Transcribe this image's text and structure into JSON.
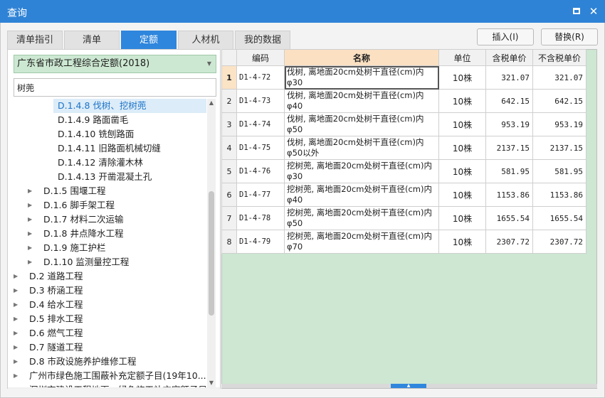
{
  "window": {
    "title": "查询"
  },
  "tabs": [
    {
      "label": "清单指引",
      "active": false
    },
    {
      "label": "清单",
      "active": false
    },
    {
      "label": "定额",
      "active": true
    },
    {
      "label": "人材机",
      "active": false
    },
    {
      "label": "我的数据",
      "active": false
    }
  ],
  "toolbar": {
    "insert_label": "插入(I)",
    "replace_label": "替换(R)"
  },
  "left": {
    "quota_library": "广东省市政工程综合定额(2018)",
    "search_value": "树蔸",
    "tree": [
      {
        "label": "D.1.4.8 伐树、挖树蔸",
        "selected": true,
        "expandable": false
      },
      {
        "label": "D.1.4.9 路面凿毛",
        "selected": false,
        "expandable": false
      },
      {
        "label": "D.1.4.10 铣刨路面",
        "selected": false,
        "expandable": false
      },
      {
        "label": "D.1.4.11 旧路面机械切缝",
        "selected": false,
        "expandable": false
      },
      {
        "label": "D.1.4.12 清除灌木林",
        "selected": false,
        "expandable": false
      },
      {
        "label": "D.1.4.13 开凿混凝土孔",
        "selected": false,
        "expandable": false
      },
      {
        "label": "D.1.5 围堰工程",
        "selected": false,
        "expandable": true
      },
      {
        "label": "D.1.6 脚手架工程",
        "selected": false,
        "expandable": true
      },
      {
        "label": "D.1.7 材料二次运输",
        "selected": false,
        "expandable": true
      },
      {
        "label": "D.1.8 井点降水工程",
        "selected": false,
        "expandable": true
      },
      {
        "label": "D.1.9 施工护栏",
        "selected": false,
        "expandable": true
      },
      {
        "label": "D.1.10 监测量控工程",
        "selected": false,
        "expandable": true
      },
      {
        "label": "D.2 道路工程",
        "selected": false,
        "expandable": true
      },
      {
        "label": "D.3 桥涵工程",
        "selected": false,
        "expandable": true
      },
      {
        "label": "D.4 给水工程",
        "selected": false,
        "expandable": true
      },
      {
        "label": "D.5 排水工程",
        "selected": false,
        "expandable": true
      },
      {
        "label": "D.6 燃气工程",
        "selected": false,
        "expandable": true
      },
      {
        "label": "D.7 隧道工程",
        "selected": false,
        "expandable": true
      },
      {
        "label": "D.8 市政设施养护维修工程",
        "selected": false,
        "expandable": true
      },
      {
        "label": "广州市绿色施工围蔽补充定额子目(19年10...",
        "selected": false,
        "expandable": true
      },
      {
        "label": "深圳市建设工程地下、绿色施工补充定额子目",
        "selected": false,
        "expandable": true
      }
    ]
  },
  "grid": {
    "columns": [
      "编码",
      "名称",
      "单位",
      "含税单价",
      "不含税单价"
    ],
    "rows": [
      {
        "n": "1",
        "code": "D1-4-72",
        "name1": "伐树, 离地面20cm处树干直径(cm)内",
        "name2": "φ30",
        "unit": "10株",
        "price_tax": "321.07",
        "price_notax": "321.07"
      },
      {
        "n": "2",
        "code": "D1-4-73",
        "name1": "伐树, 离地面20cm处树干直径(cm)内",
        "name2": "φ40",
        "unit": "10株",
        "price_tax": "642.15",
        "price_notax": "642.15"
      },
      {
        "n": "3",
        "code": "D1-4-74",
        "name1": "伐树, 离地面20cm处树干直径(cm)内",
        "name2": "φ50",
        "unit": "10株",
        "price_tax": "953.19",
        "price_notax": "953.19"
      },
      {
        "n": "4",
        "code": "D1-4-75",
        "name1": "伐树, 离地面20cm处树干直径(cm)内",
        "name2": "φ50以外",
        "unit": "10株",
        "price_tax": "2137.15",
        "price_notax": "2137.15"
      },
      {
        "n": "5",
        "code": "D1-4-76",
        "name1": "挖树蔸, 离地面20cm处树干直径(cm)内",
        "name2": "φ30",
        "unit": "10株",
        "price_tax": "581.95",
        "price_notax": "581.95"
      },
      {
        "n": "6",
        "code": "D1-4-77",
        "name1": "挖树蔸, 离地面20cm处树干直径(cm)内",
        "name2": "φ40",
        "unit": "10株",
        "price_tax": "1153.86",
        "price_notax": "1153.86"
      },
      {
        "n": "7",
        "code": "D1-4-78",
        "name1": "挖树蔸, 离地面20cm处树干直径(cm)内",
        "name2": "φ50",
        "unit": "10株",
        "price_tax": "1655.54",
        "price_notax": "1655.54"
      },
      {
        "n": "8",
        "code": "D1-4-79",
        "name1": "挖树蔸, 离地面20cm处树干直径(cm)内",
        "name2": "φ70",
        "unit": "10株",
        "price_tax": "2307.72",
        "price_notax": "2307.72"
      }
    ]
  }
}
